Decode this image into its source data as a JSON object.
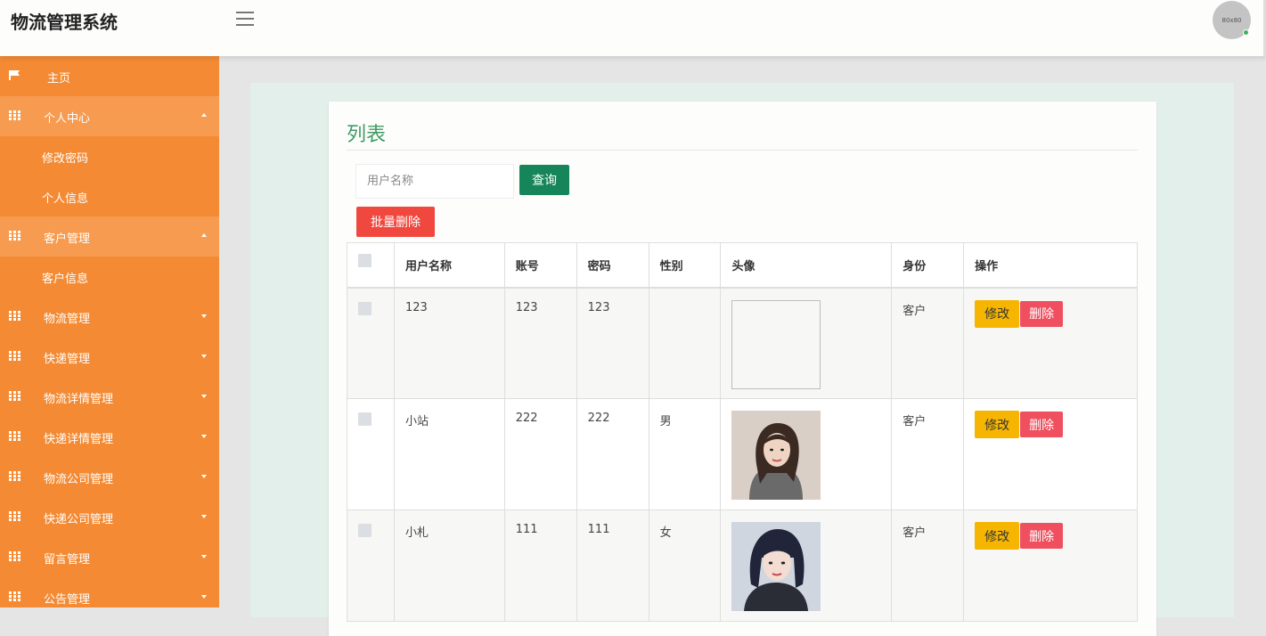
{
  "app": {
    "title": "物流管理系统",
    "avatar_text": "80x80"
  },
  "sidebar": {
    "items": [
      {
        "label": "主页",
        "icon": "flag-icon"
      },
      {
        "label": "个人中心",
        "icon": "grid-icon",
        "expanded": true
      },
      {
        "label": "修改密码",
        "sub": true
      },
      {
        "label": "个人信息",
        "sub": true
      },
      {
        "label": "客户管理",
        "icon": "grid-icon",
        "expanded": true
      },
      {
        "label": "客户信息",
        "sub": true
      },
      {
        "label": "物流管理",
        "icon": "grid-icon"
      },
      {
        "label": "快递管理",
        "icon": "grid-icon"
      },
      {
        "label": "物流详情管理",
        "icon": "grid-icon"
      },
      {
        "label": "快递详情管理",
        "icon": "grid-icon"
      },
      {
        "label": "物流公司管理",
        "icon": "grid-icon"
      },
      {
        "label": "快递公司管理",
        "icon": "grid-icon"
      },
      {
        "label": "留言管理",
        "icon": "grid-icon"
      },
      {
        "label": "公告管理",
        "icon": "grid-icon"
      }
    ]
  },
  "main": {
    "title": "列表",
    "search": {
      "placeholder": "用户名称",
      "value": ""
    },
    "query_label": "查询",
    "batch_delete_label": "批量删除",
    "table": {
      "headers": [
        "用户名称",
        "账号",
        "密码",
        "性别",
        "头像",
        "身份",
        "操作"
      ],
      "rows": [
        {
          "name": "123",
          "account": "123",
          "password": "123",
          "gender": "",
          "avatar": "broken-image",
          "role": "客户"
        },
        {
          "name": "小站",
          "account": "222",
          "password": "222",
          "gender": "男",
          "avatar": "photo-woman-1",
          "role": "客户"
        },
        {
          "name": "小札",
          "account": "111",
          "password": "111",
          "gender": "女",
          "avatar": "photo-woman-2",
          "role": "客户"
        }
      ],
      "edit_label": "修改",
      "delete_label": "删除"
    }
  },
  "colors": {
    "sidebar": "#f48b34",
    "accent_green": "#17855a",
    "danger": "#f0483f",
    "warning": "#f6b501"
  }
}
